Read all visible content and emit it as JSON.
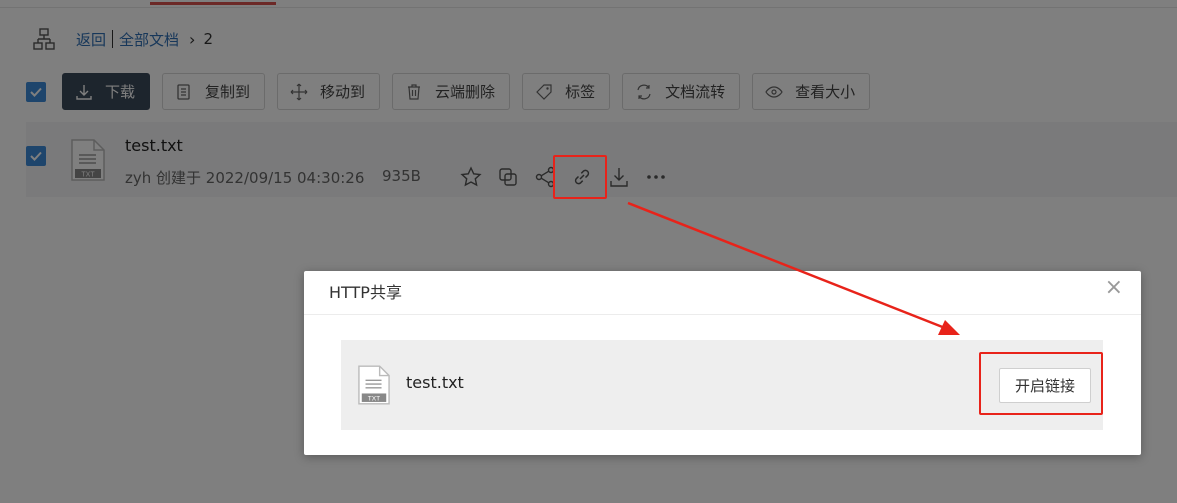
{
  "breadcrumb": {
    "back": "返回",
    "all_docs": "全部文档",
    "current": "2"
  },
  "toolbar": {
    "download": "下载",
    "copy_to": "复制到",
    "move_to": "移动到",
    "cloud_delete": "云端删除",
    "tags": "标签",
    "doc_flow": "文档流转",
    "view_size": "查看大小"
  },
  "file": {
    "name": "test.txt",
    "meta": "zyh 创建于 2022/09/15 04:30:26",
    "size": "935B",
    "type_label": "TXT"
  },
  "dialog": {
    "title": "HTTP共享",
    "close_symbol": "×",
    "file_name": "test.txt",
    "enable_link_button": "开启链接"
  },
  "colors": {
    "accent": "#3d8bd8",
    "highlight_red": "#e8231a",
    "primary_button": "#3b4a5a"
  }
}
